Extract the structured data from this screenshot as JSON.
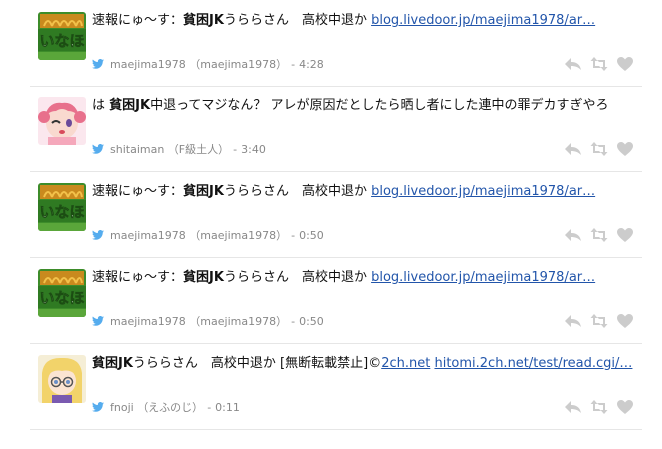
{
  "tweets": [
    {
      "prefix": "速報にゅ〜す：",
      "bold": "貧困JK",
      "text": "うららさん　高校中退か ",
      "link": "blog.livedoor.jp/maejima1978/ar…",
      "link2": "",
      "user": "maejima1978",
      "name": "（maejima1978）",
      "time": "4:28",
      "avatar": "inaho"
    },
    {
      "prefix": "は ",
      "bold": "貧困JK",
      "text": "中退ってマジなん？ アレが原因だとしたら晒し者にした連中の罪デカすぎやろ",
      "link": "",
      "link2": "",
      "user": "shitaiman",
      "name": "（F級土人）",
      "time": "3:40",
      "avatar": "anime-pink"
    },
    {
      "prefix": "速報にゅ〜す：",
      "bold": "貧困JK",
      "text": "うららさん　高校中退か ",
      "link": "blog.livedoor.jp/maejima1978/ar…",
      "link2": "",
      "user": "maejima1978",
      "name": "（maejima1978）",
      "time": "0:50",
      "avatar": "inaho"
    },
    {
      "prefix": "速報にゅ〜す：",
      "bold": "貧困JK",
      "text": "うららさん　高校中退か ",
      "link": "blog.livedoor.jp/maejima1978/ar…",
      "link2": "",
      "user": "maejima1978",
      "name": "（maejima1978）",
      "time": "0:50",
      "avatar": "inaho"
    },
    {
      "prefix": "",
      "bold": "貧困JK",
      "text": "うららさん　高校中退か [無断転載禁止]©",
      "link": "2ch.net",
      "link2": "hitomi.2ch.net/test/read.cgi/…",
      "user": "fnoji",
      "name": "（えふのじ）",
      "time": "0:11",
      "avatar": "anime-blonde"
    }
  ],
  "meta_separator": "-",
  "icons": {
    "bird": "twitter-bird-icon",
    "reply": "reply-icon",
    "retweet": "retweet-icon",
    "like": "heart-icon"
  },
  "colors": {
    "link": "#2255aa",
    "meta": "#888888",
    "bird": "#55acee",
    "action": "#cccccc",
    "inaho_bg": "#3d8c2a",
    "inaho_text": "#ffffff"
  },
  "avatar_text": {
    "inaho": "いなほ"
  }
}
